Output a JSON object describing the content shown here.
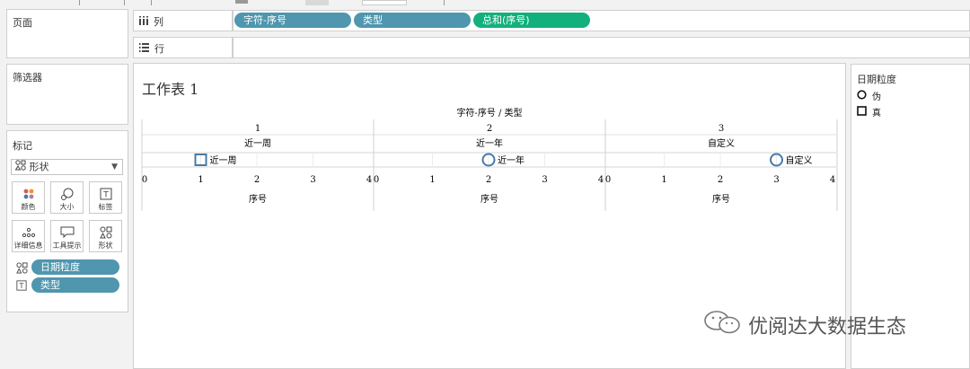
{
  "panels": {
    "pages_title": "页面",
    "filters_title": "筛选器",
    "marks_title": "标记"
  },
  "shelves": {
    "columns_label": "列",
    "rows_label": "行",
    "column_pills": [
      {
        "label": "字符-序号",
        "color": "#4f96ae"
      },
      {
        "label": "类型",
        "color": "#4f96ae"
      },
      {
        "label": "总和(序号)",
        "color": "#12b07c"
      }
    ]
  },
  "marks": {
    "mark_type": "形状",
    "buttons": [
      {
        "label": "颜色",
        "icon": "color-dots-icon"
      },
      {
        "label": "大小",
        "icon": "size-icon"
      },
      {
        "label": "标签",
        "icon": "label-icon"
      },
      {
        "label": "详细信息",
        "icon": "detail-icon"
      },
      {
        "label": "工具提示",
        "icon": "tooltip-icon"
      },
      {
        "label": "形状",
        "icon": "shape-icon"
      }
    ],
    "fields": [
      {
        "label": "日期粒度",
        "icon": "shape-icon"
      },
      {
        "label": "类型",
        "icon": "text-icon"
      }
    ]
  },
  "worksheet": {
    "title": "工作表 1",
    "header_title": "字符-序号 / 类型",
    "xlabel": "序号"
  },
  "chart_data": {
    "type": "scatter",
    "title": "",
    "panes": [
      {
        "group": "1",
        "category": "近一周",
        "x": 1,
        "label": "近一周",
        "shape": "square"
      },
      {
        "group": "2",
        "category": "近一年",
        "x": 2,
        "label": "近一年",
        "shape": "circle"
      },
      {
        "group": "3",
        "category": "自定义",
        "x": 3,
        "label": "自定义",
        "shape": "circle"
      }
    ],
    "xlim": [
      0,
      4
    ],
    "xticks": [
      "0",
      "1",
      "2",
      "3",
      "4"
    ],
    "mark_color": "#4a7aa6"
  },
  "legend": {
    "title": "日期粒度",
    "items": [
      {
        "label": "伪",
        "shape": "circle"
      },
      {
        "label": "真",
        "shape": "square"
      }
    ]
  },
  "watermark": "优阅达大数据生态"
}
